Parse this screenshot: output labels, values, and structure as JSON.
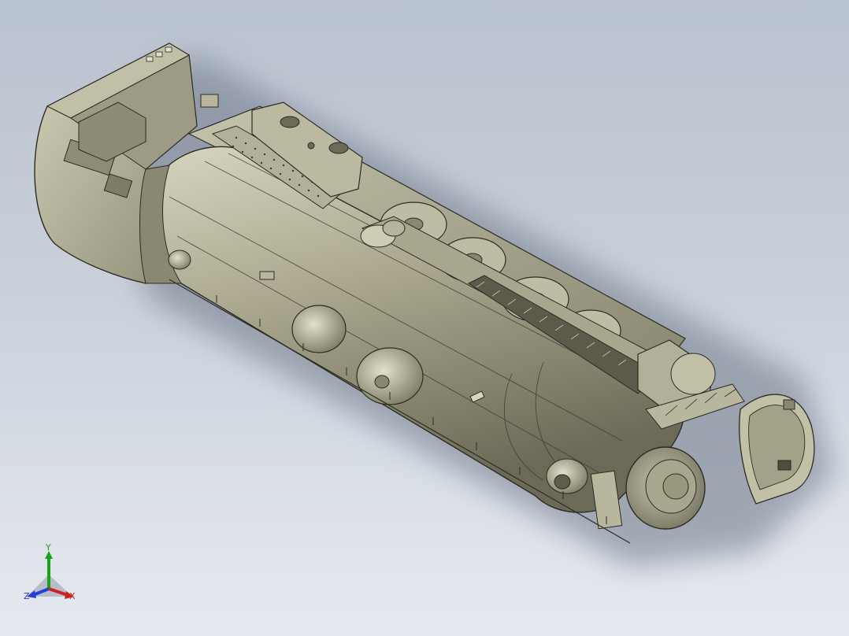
{
  "viewport": {
    "background_top": "#b9c2cf",
    "background_bottom": "#e6eaf0",
    "model_name": "steam-locomotive-assembly",
    "model_color": "#b7b49a",
    "edge_color": "#2c2c24"
  },
  "triad": {
    "y_label": "Y",
    "x_label": "X",
    "z_label": "Z",
    "y_color": "#1aa21a",
    "x_color": "#cc2222",
    "z_color": "#2a3fd6"
  }
}
